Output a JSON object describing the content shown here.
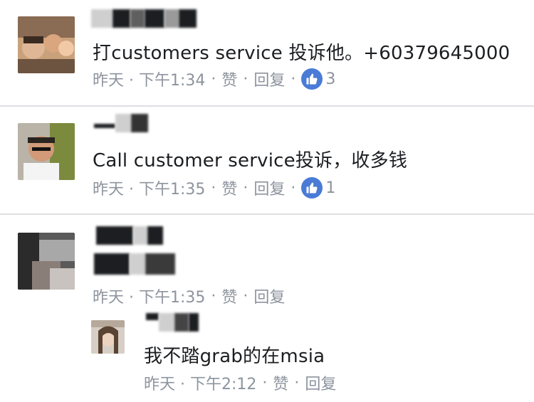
{
  "comments": [
    {
      "text": "打customers service 投诉他。+60379645000",
      "time": "昨天 · 下午1:34",
      "like_action": "赞",
      "reply_action": "回复",
      "like_count": "3"
    },
    {
      "text": "Call customer service投诉，收多钱",
      "time": "昨天 · 下午1:35",
      "like_action": "赞",
      "reply_action": "回复",
      "like_count": "1"
    },
    {
      "text": "",
      "time": "昨天 · 下午1:35",
      "like_action": "赞",
      "reply_action": "回复"
    },
    {
      "text": "我不踏grab的在msia",
      "time": "昨天 · 下午2:12",
      "like_action": "赞",
      "reply_action": "回复"
    }
  ],
  "colors": {
    "like_badge": "#4a7bd6",
    "meta_gray": "#8d949e",
    "divider": "#dddfe2"
  }
}
